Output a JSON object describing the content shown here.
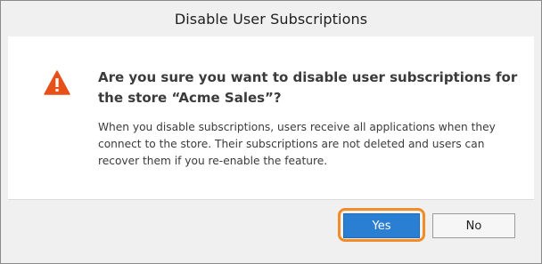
{
  "dialog": {
    "title": "Disable User Subscriptions",
    "icon": "warning-icon",
    "heading": "Are you sure you want to disable user subscriptions for the store “Acme Sales”?",
    "message": "When you disable subscriptions, users receive all applications when they connect to the store. Their subscriptions are not deleted and users can recover them if you re-enable the feature.",
    "buttons": {
      "yes_label": "Yes",
      "no_label": "No"
    }
  },
  "colors": {
    "warning": "#e8501a",
    "primary_button": "#2a7fd2",
    "focus_ring": "#f28c28"
  }
}
